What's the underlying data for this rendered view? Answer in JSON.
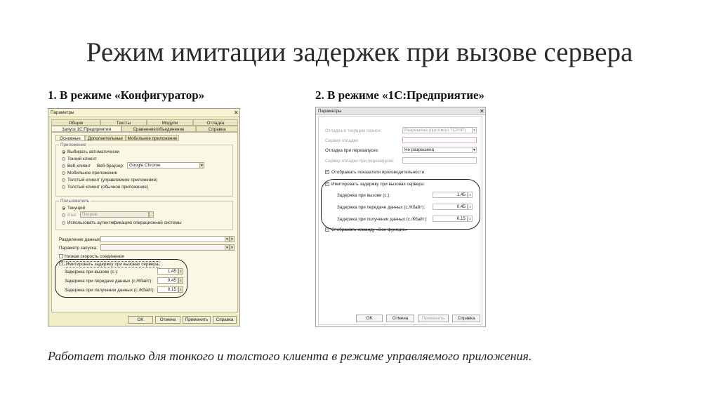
{
  "slide": {
    "title": "Режим имитации задержек при вызове сервера",
    "sub1": "1. В режиме «Конфигуратор»",
    "sub2": "2. В режиме «1С:Предприятие»",
    "note": "Работает только для тонкого и толстого клиента в режиме управляемого приложения."
  },
  "config_dialog": {
    "title": "Параметры",
    "tabs_row1": [
      "Общие",
      "Тексты",
      "Модули",
      "Отладка"
    ],
    "tabs_row2": [
      "Запуск 1С:Предприятия",
      "Сравнение/объединение",
      "Справка"
    ],
    "subtabs": [
      "Основные",
      "Дополнительные",
      "Мобильное приложение"
    ],
    "app_group": "Приложение",
    "app_options": [
      "Выбирать автоматически",
      "Тонкий клиент",
      "Веб-клиент",
      "Мобильное приложение",
      "Толстый клиент (управляемое приложение)",
      "Толстый клиент (обычное приложение)"
    ],
    "browser_label": "Веб-браузер:",
    "browser_value": "Google Chrome",
    "user_group": "Пользователь",
    "user_current": "Текущий",
    "user_name_label": "Имя:",
    "user_name_value": "Петров",
    "user_os_auth": "Использовать аутентификацию операционной системы",
    "separation_label": "Разделение данных:",
    "startup_param_label": "Параметр запуска:",
    "low_speed": "Низкая скорость соединения",
    "simulate_delay": "Имитировать задержку при вызовах сервера",
    "delay_call_label": "Задержка при вызове (с.):",
    "delay_call_value": "1,45",
    "delay_send_label": "Задержка при передаче данных (с./Кбайт):",
    "delay_send_value": "0,45",
    "delay_recv_label": "Задержка при получении данных (с./Кбайт):",
    "delay_recv_value": "0,15",
    "btn_ok": "OK",
    "btn_cancel": "Отмена",
    "btn_apply": "Применить",
    "btn_help": "Справка"
  },
  "enterprise_dialog": {
    "title": "Параметры",
    "debug_session_label": "Отладка в текущем сеансе:",
    "debug_session_value": "Разрешена (протокол TCP/IP)",
    "debug_server_label": "Сервер отладки",
    "debug_restart_label": "Отладка при перезапуске:",
    "debug_restart_value": "Не разрешена",
    "debug_server_restart_label": "Сервер отладки при перезапуске:",
    "show_perf": "Отображать показатели производительности",
    "simulate_delay": "Имитировать задержку при вызовах сервера:",
    "delay_call_label": "Задержка при вызове (с.):",
    "delay_call_value": "1,45",
    "delay_send_label": "Задержка при передаче данных (с./Кбайт):",
    "delay_send_value": "0,45",
    "delay_recv_label": "Задержка при получении данных (с./Кбайт):",
    "delay_recv_value": "0,15",
    "show_all_functions": "Отображать команду «Все функции»",
    "btn_ok": "OK",
    "btn_cancel": "Отмена",
    "btn_apply": "Применить",
    "btn_help": "Справка"
  }
}
